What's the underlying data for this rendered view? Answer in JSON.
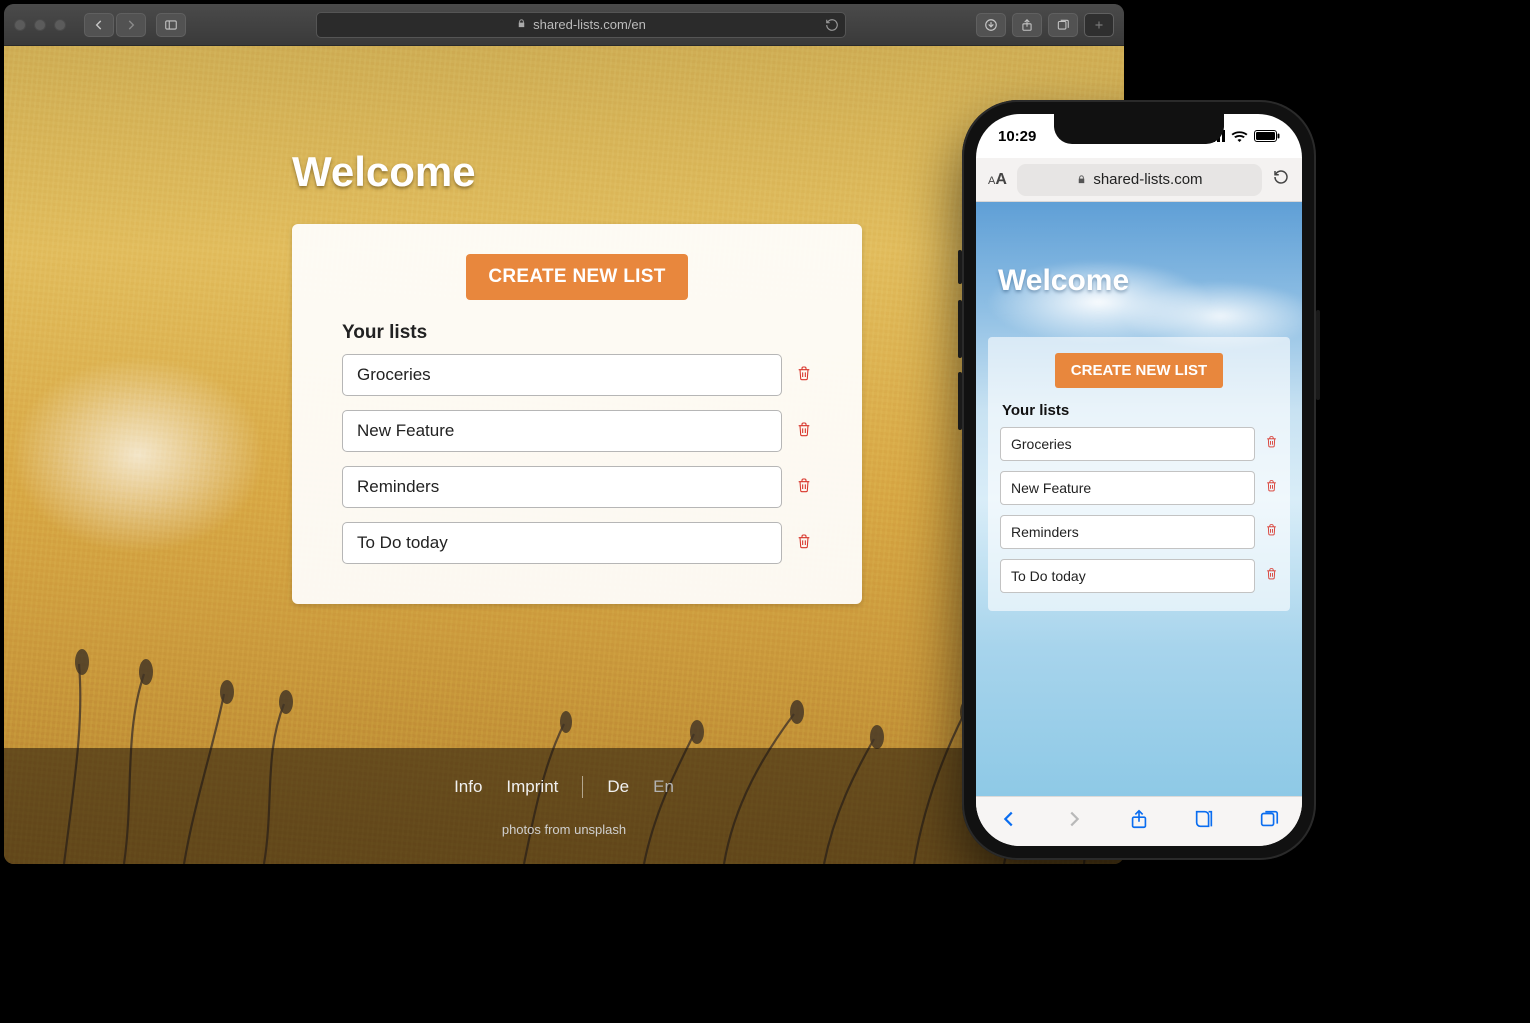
{
  "desktop": {
    "url": "shared-lists.com/en",
    "welcome": "Welcome",
    "create_label": "CREATE NEW LIST",
    "your_lists_label": "Your lists",
    "lists": [
      "Groceries",
      "New Feature",
      "Reminders",
      "To Do today"
    ],
    "footer": {
      "info": "Info",
      "imprint": "Imprint",
      "de": "De",
      "en": "En",
      "credit": "photos from unsplash"
    }
  },
  "mobile": {
    "time": "10:29",
    "url": "shared-lists.com",
    "welcome": "Welcome",
    "create_label": "CREATE NEW LIST",
    "your_lists_label": "Your lists",
    "lists": [
      "Groceries",
      "New Feature",
      "Reminders",
      "To Do today"
    ]
  }
}
